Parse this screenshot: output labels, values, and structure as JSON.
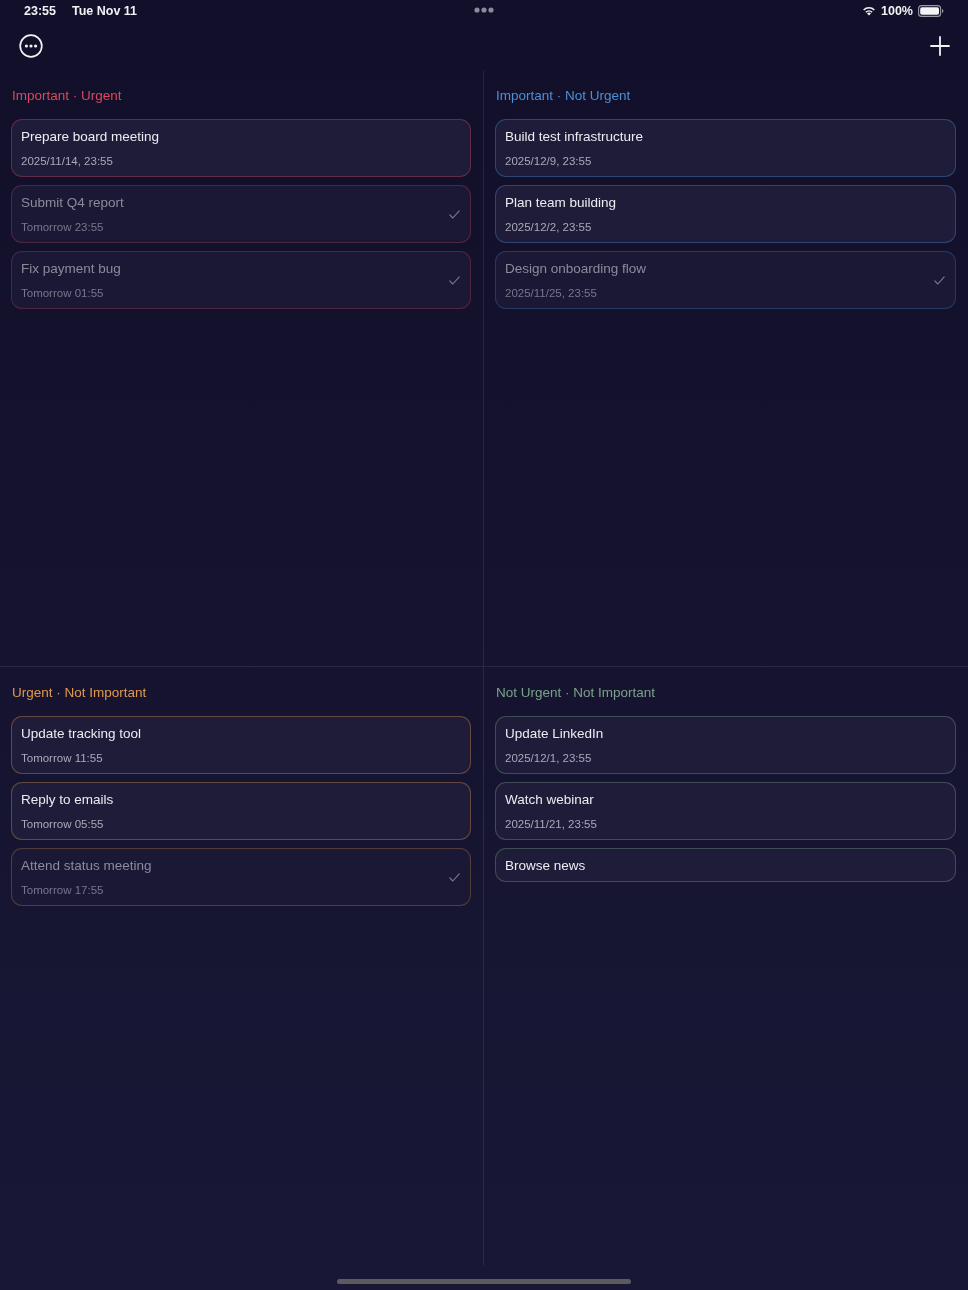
{
  "status_bar": {
    "time": "23:55",
    "date": "Tue Nov 11",
    "battery": "100%"
  },
  "quadrants": [
    {
      "title": "Important · Urgent",
      "color": "#d94a5c",
      "tasks": [
        {
          "title": "Prepare board meeting",
          "due": "2025/11/14, 23:55",
          "done": false
        },
        {
          "title": "Submit Q4 report",
          "due": "Tomorrow 23:55",
          "done": true
        },
        {
          "title": "Fix payment bug",
          "due": "Tomorrow 01:55",
          "done": true
        }
      ]
    },
    {
      "title": "Important · Not Urgent",
      "color": "#4d8fd6",
      "tasks": [
        {
          "title": "Build test infrastructure",
          "due": "2025/12/9, 23:55",
          "done": false
        },
        {
          "title": "Plan team building",
          "due": "2025/12/2, 23:55",
          "done": false
        },
        {
          "title": "Design onboarding flow",
          "due": "2025/11/25, 23:55",
          "done": true
        }
      ]
    },
    {
      "title": "Urgent · Not Important",
      "color": "#e0994c",
      "tasks": [
        {
          "title": "Update tracking tool",
          "due": "Tomorrow 11:55",
          "done": false
        },
        {
          "title": "Reply to emails",
          "due": "Tomorrow 05:55",
          "done": false
        },
        {
          "title": "Attend status meeting",
          "due": "Tomorrow 17:55",
          "done": true
        }
      ]
    },
    {
      "title": "Not Urgent · Not Important",
      "color": "#7aa386",
      "tasks": [
        {
          "title": "Update LinkedIn",
          "due": "2025/12/1, 23:55",
          "done": false
        },
        {
          "title": "Watch webinar",
          "due": "2025/11/21, 23:55",
          "done": false
        },
        {
          "title": "Browse news",
          "done": false
        }
      ]
    }
  ]
}
